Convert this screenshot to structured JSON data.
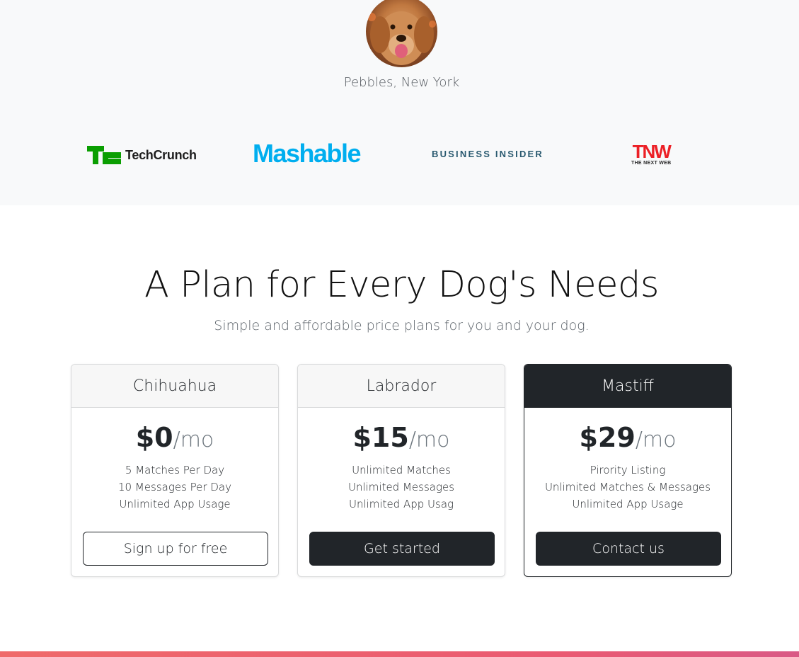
{
  "testimonial": {
    "name": "Pebbles, New York"
  },
  "press_logos": {
    "techcrunch": "TechCrunch",
    "mashable": "Mashable",
    "business_insider": "BUSINESS INSIDER",
    "tnw": "TNW",
    "tnw_tagline": "THE NEXT WEB"
  },
  "pricing": {
    "title": "A Plan for Every Dog's Needs",
    "subtitle": "Simple and affordable price plans for you and your dog.",
    "plans": [
      {
        "name": "Chihuahua",
        "price": "$0",
        "period": "/mo",
        "features": [
          "5 Matches Per Day",
          "10 Messages Per Day",
          "Unlimited App Usage"
        ],
        "button": "Sign up for free"
      },
      {
        "name": "Labrador",
        "price": "$15",
        "period": "/mo",
        "features": [
          "Unlimited Matches",
          "Unlimited Messages",
          "Unlimited App Usag"
        ],
        "button": "Get started"
      },
      {
        "name": "Mastiff",
        "price": "$29",
        "period": "/mo",
        "features": [
          "Pirority Listing",
          "Unlimited Matches & Messages",
          "Unlimited App Usage"
        ],
        "button": "Contact us"
      }
    ]
  },
  "colors": {
    "dark": "#212529",
    "band": "#f8f9fa",
    "mashable": "#00aeef",
    "techcrunch": "#0a9e01",
    "tnw": "#ec2026",
    "accent_bar": "#ef6a6a"
  }
}
